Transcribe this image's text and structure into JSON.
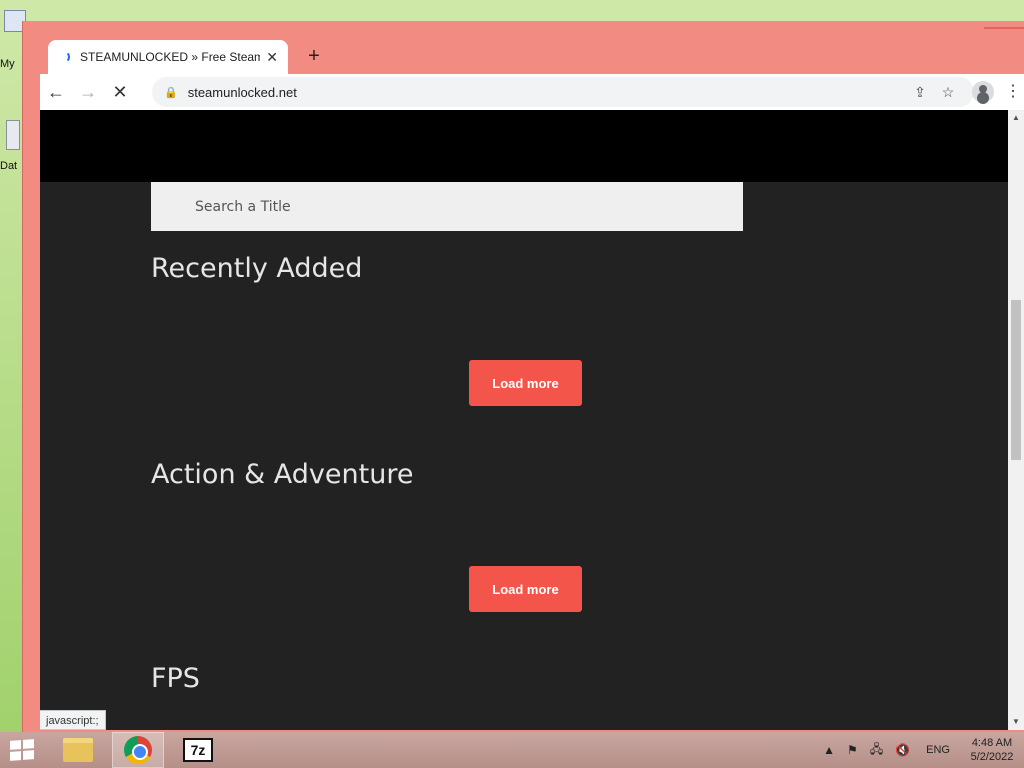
{
  "desktop": {
    "icons": [
      {
        "label": "My"
      },
      {
        "label": "Dat"
      }
    ]
  },
  "browser": {
    "tab_title": "STEAMUNLOCKED » Free Steam",
    "tab_close": "✕",
    "new_tab": "+",
    "url": "steamunlocked.net",
    "window_controls": {
      "minimize": "—",
      "close": "✕"
    },
    "nav": {
      "back": "←",
      "forward": "→",
      "stop": "✕"
    },
    "omnibox_icons": {
      "lock": "🔒",
      "share": "⇪",
      "star": "☆"
    },
    "menu": "⋮",
    "status_tip": "javascript:;"
  },
  "page": {
    "search": {
      "placeholder": "Search a Title"
    },
    "sections": [
      {
        "title": "Recently Added",
        "button": "Load more"
      },
      {
        "title": "Action & Adventure",
        "button": "Load more"
      },
      {
        "title": "FPS"
      }
    ],
    "colors": {
      "accent": "#f4554a",
      "background": "#222222",
      "header": "#000000"
    }
  },
  "taskbar": {
    "apps": [
      {
        "name": "file-explorer"
      },
      {
        "name": "google-chrome",
        "active": true
      },
      {
        "name": "7-zip",
        "label": "7z"
      }
    ],
    "tray": {
      "up_arrow": "▲",
      "flag": "⚑",
      "network": "🖧",
      "volume": "🔇",
      "language": "ENG"
    },
    "time": "4:48 AM",
    "date": "5/2/2022"
  }
}
